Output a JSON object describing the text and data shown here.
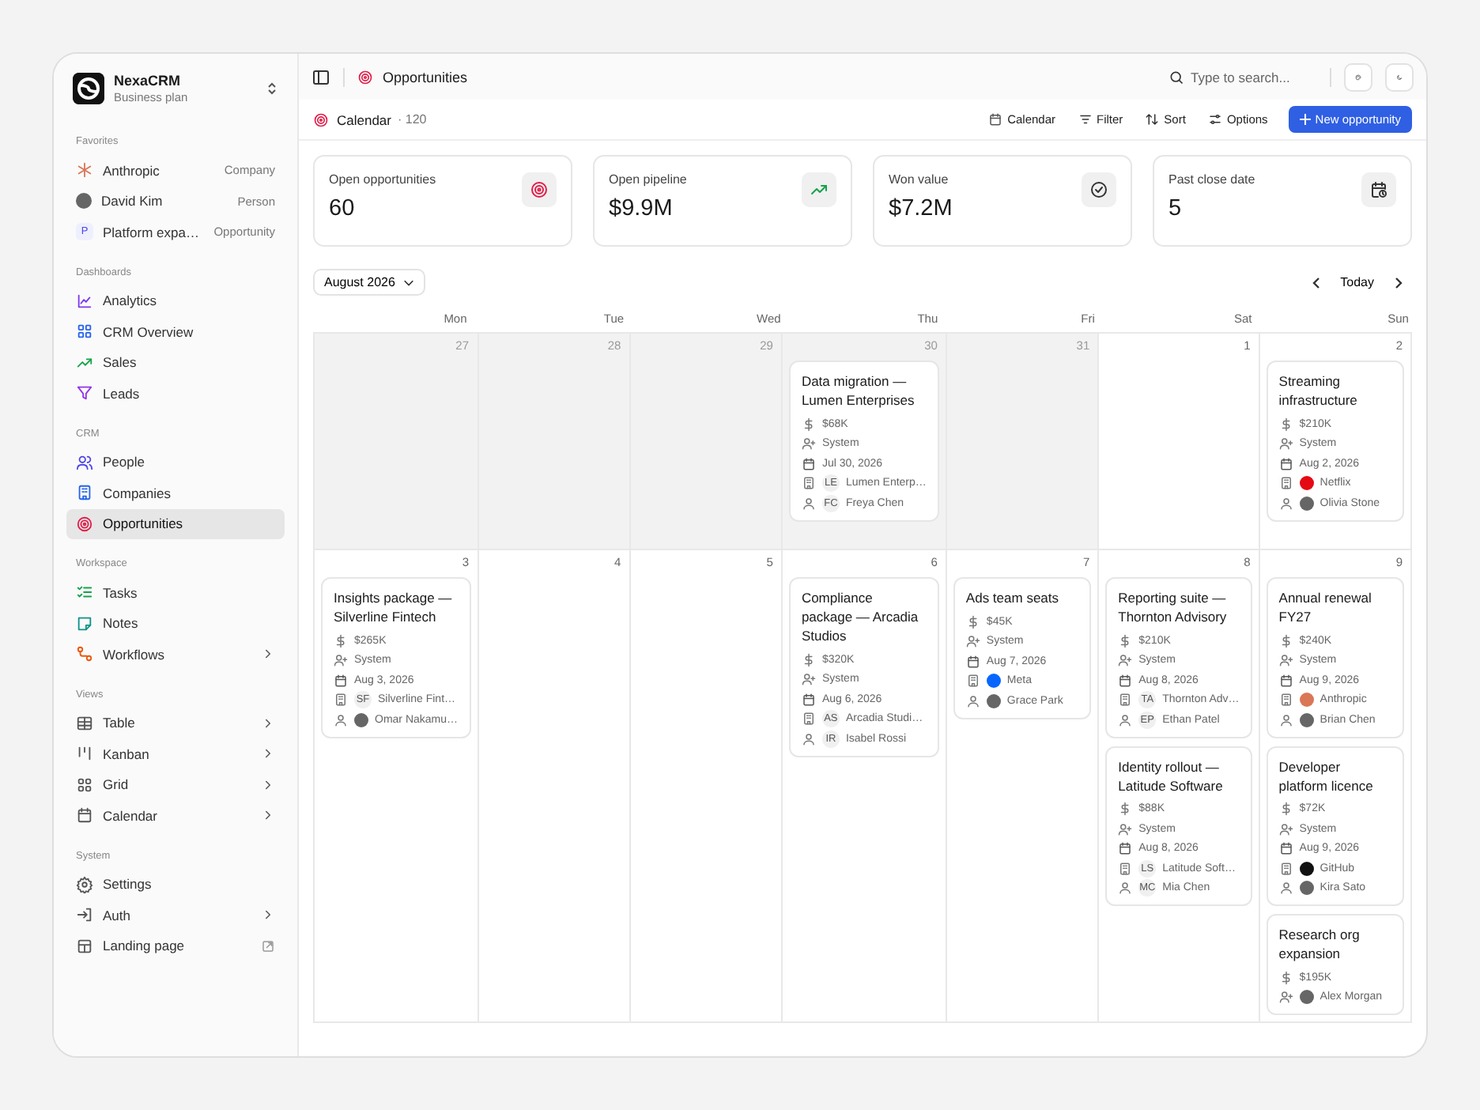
{
  "sidebar": {
    "workspace": {
      "name": "NexaCRM",
      "plan": "Business plan"
    },
    "sections": [
      {
        "title": "Favorites",
        "items": [
          {
            "label": "Anthropic",
            "type": "Company",
            "selected": false
          },
          {
            "label": "David Kim",
            "type": "Person",
            "selected": false
          },
          {
            "label": "Platform expa…",
            "badge": "P",
            "type": "Opportunity",
            "selected": false
          }
        ]
      },
      {
        "title": "Dashboards",
        "items": [
          {
            "label": "Analytics",
            "expandable": false,
            "selected": false
          },
          {
            "label": "CRM Overview",
            "expandable": false,
            "selected": false
          },
          {
            "label": "Sales",
            "expandable": false,
            "selected": false
          },
          {
            "label": "Leads",
            "expandable": false,
            "selected": false
          }
        ]
      },
      {
        "title": "CRM",
        "items": [
          {
            "label": "People",
            "expandable": false,
            "selected": false
          },
          {
            "label": "Companies",
            "expandable": false,
            "selected": false
          },
          {
            "label": "Opportunities",
            "expandable": false,
            "selected": true
          }
        ]
      },
      {
        "title": "Workspace",
        "items": [
          {
            "label": "Tasks",
            "expandable": false,
            "selected": false
          },
          {
            "label": "Notes",
            "expandable": false,
            "selected": false
          },
          {
            "label": "Workflows",
            "expandable": true,
            "selected": false
          }
        ]
      },
      {
        "title": "Views",
        "items": [
          {
            "label": "Table",
            "expandable": true,
            "selected": false
          },
          {
            "label": "Kanban",
            "expandable": true,
            "selected": false
          },
          {
            "label": "Grid",
            "expandable": true,
            "selected": false
          },
          {
            "label": "Calendar",
            "expandable": true,
            "selected": false
          }
        ]
      },
      {
        "title": "System",
        "items": [
          {
            "label": "Settings",
            "expandable": false,
            "selected": false
          },
          {
            "label": "Auth",
            "expandable": true,
            "selected": false
          },
          {
            "label": "Landing page",
            "expandable": false,
            "external": true,
            "selected": false
          }
        ]
      }
    ]
  },
  "topbar": {
    "title": "Opportunities",
    "search": {
      "placeholder": "Type to search..."
    }
  },
  "toolbar": {
    "view": "Calendar",
    "count": "· 120",
    "actions": [
      "Calendar",
      "Filter",
      "Sort",
      "Options"
    ],
    "primary": "New opportunity"
  },
  "stats": [
    {
      "label": "Open opportunities",
      "value": "60"
    },
    {
      "label": "Open pipeline",
      "value": "$9.9M"
    },
    {
      "label": "Won value",
      "value": "$7.2M"
    },
    {
      "label": "Past close date",
      "value": "5"
    }
  ],
  "calendar": {
    "month": "August 2026",
    "today": "Today",
    "weekdays": [
      "Mon",
      "Tue",
      "Wed",
      "Thu",
      "Fri",
      "Sat",
      "Sun"
    ],
    "weeks": [
      [
        {
          "day": "27",
          "outside": true
        },
        {
          "day": "28",
          "outside": true
        },
        {
          "day": "29",
          "outside": true
        },
        {
          "day": "30",
          "outside": true,
          "deals": [
            {
              "title": "Data migration — Lumen Enterprises",
              "amount": "$68K",
              "owner": {
                "name": "System"
              },
              "date": "Jul 30, 2026",
              "company": {
                "name": "Lumen Enterp…",
                "badge": "LE"
              },
              "contact": {
                "name": "Freya Chen",
                "badge": "FC"
              }
            }
          ]
        },
        {
          "day": "31",
          "outside": true
        },
        {
          "day": "1",
          "outside": false
        },
        {
          "day": "2",
          "outside": false,
          "deals": [
            {
              "title": "Streaming infrastructure",
              "amount": "$210K",
              "owner": {
                "name": "System"
              },
              "date": "Aug 2, 2026",
              "company": {
                "name": "Netflix",
                "color": "#e50914"
              },
              "contact": {
                "name": "Olivia Stone",
                "photo": true
              }
            }
          ]
        }
      ],
      [
        {
          "day": "3",
          "outside": false,
          "deals": [
            {
              "title": "Insights package — Silverline Fintech",
              "amount": "$265K",
              "owner": {
                "name": "System"
              },
              "date": "Aug 3, 2026",
              "company": {
                "name": "Silverline Fint…",
                "badge": "SF"
              },
              "contact": {
                "name": "Omar Nakamu…",
                "photo": true
              }
            }
          ]
        },
        {
          "day": "4",
          "outside": false
        },
        {
          "day": "5",
          "outside": false
        },
        {
          "day": "6",
          "outside": false,
          "deals": [
            {
              "title": "Compliance package — Arcadia Studios",
              "amount": "$320K",
              "owner": {
                "name": "System"
              },
              "date": "Aug 6, 2026",
              "company": {
                "name": "Arcadia Studi…",
                "badge": "AS"
              },
              "contact": {
                "name": "Isabel Rossi",
                "badge": "IR"
              }
            }
          ]
        },
        {
          "day": "7",
          "outside": false,
          "deals": [
            {
              "title": "Ads team seats",
              "amount": "$45K",
              "owner": {
                "name": "System"
              },
              "date": "Aug 7, 2026",
              "company": {
                "name": "Meta",
                "color": "#0866ff"
              },
              "contact": {
                "name": "Grace Park",
                "photo": true
              }
            }
          ]
        },
        {
          "day": "8",
          "outside": false,
          "deals": [
            {
              "title": "Reporting suite — Thornton Advisory",
              "amount": "$210K",
              "owner": {
                "name": "System"
              },
              "date": "Aug 8, 2026",
              "company": {
                "name": "Thornton Adv…",
                "badge": "TA"
              },
              "contact": {
                "name": "Ethan Patel",
                "badge": "EP"
              }
            },
            {
              "title": "Identity rollout — Latitude Software",
              "amount": "$88K",
              "owner": {
                "name": "System"
              },
              "date": "Aug 8, 2026",
              "company": {
                "name": "Latitude Soft…",
                "badge": "LS"
              },
              "contact": {
                "name": "Mia Chen",
                "badge": "MC"
              }
            }
          ]
        },
        {
          "day": "9",
          "outside": false,
          "deals": [
            {
              "title": "Annual renewal FY27",
              "amount": "$240K",
              "owner": {
                "name": "System"
              },
              "date": "Aug 9, 2026",
              "company": {
                "name": "Anthropic",
                "color": "#d97757"
              },
              "contact": {
                "name": "Brian Chen",
                "photo": true
              }
            },
            {
              "title": "Developer platform licence",
              "amount": "$72K",
              "owner": {
                "name": "System"
              },
              "date": "Aug 9, 2026",
              "company": {
                "name": "GitHub",
                "color": "#111111"
              },
              "contact": {
                "name": "Kira Sato",
                "photo": true
              }
            },
            {
              "title": "Research org expansion",
              "amount": "$195K",
              "owner": {
                "name": "Alex Morgan",
                "photo": true
              }
            }
          ]
        }
      ]
    ]
  }
}
